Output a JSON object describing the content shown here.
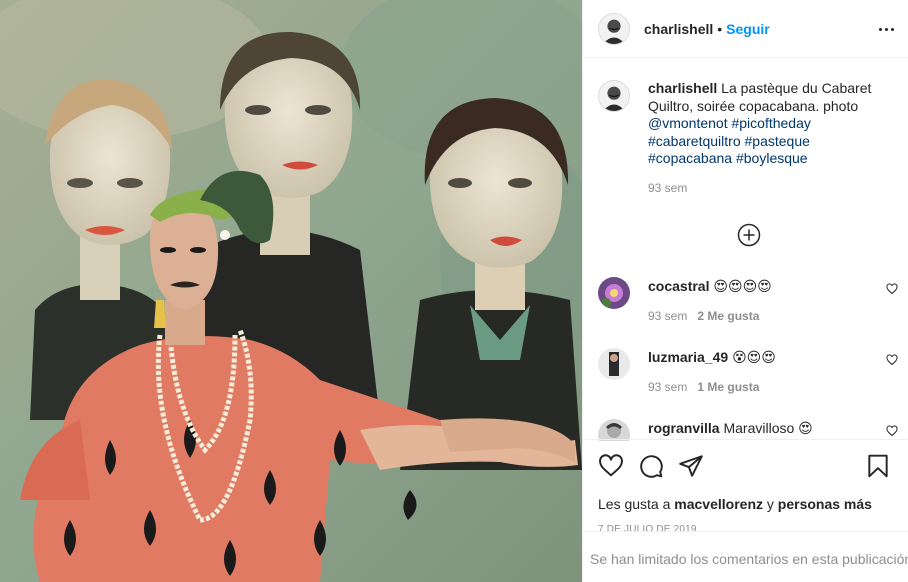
{
  "post": {
    "image_alt": "Performer in watermelon costume in front of painting of three faces",
    "author": "charlishell",
    "separator": "•",
    "follow_label": "Seguir",
    "more_icon": "more-options-icon"
  },
  "caption": {
    "username": "charlishell",
    "text": "La pastèque du Cabaret Quiltro, soirée copacabana. photo",
    "mention": "@vmontenot",
    "tags": [
      "#picoftheday",
      "#cabaretquiltro",
      "#pasteque",
      "#copacabana",
      "#boylesque"
    ],
    "time": "93 sem"
  },
  "load_more_icon": "plus-circle-icon",
  "comments": [
    {
      "username": "cocastral",
      "text": "😍😍😍😍",
      "time": "93 sem",
      "likes": "2 Me gusta"
    },
    {
      "username": "luzmaria_49",
      "text": "😵😍😍",
      "time": "93 sem",
      "likes": "1 Me gusta"
    },
    {
      "username": "rogranvilla",
      "text": "Maravilloso 😍",
      "time": "",
      "likes": ""
    }
  ],
  "actions": {
    "icons": [
      "heart-icon",
      "comment-icon",
      "share-icon",
      "bookmark-icon"
    ],
    "likes_prefix": "Les gusta a",
    "likes_user": "macvellorenz",
    "likes_join": "y",
    "likes_others": "personas más",
    "date": "7 DE JULIO DE 2019"
  },
  "comments_limited": "Se han limitado los comentarios en esta publicación.",
  "colors": {
    "link_blue": "#0095f6",
    "hashtag": "#00376b",
    "muted": "#8e8e8e",
    "border": "#efefef"
  }
}
